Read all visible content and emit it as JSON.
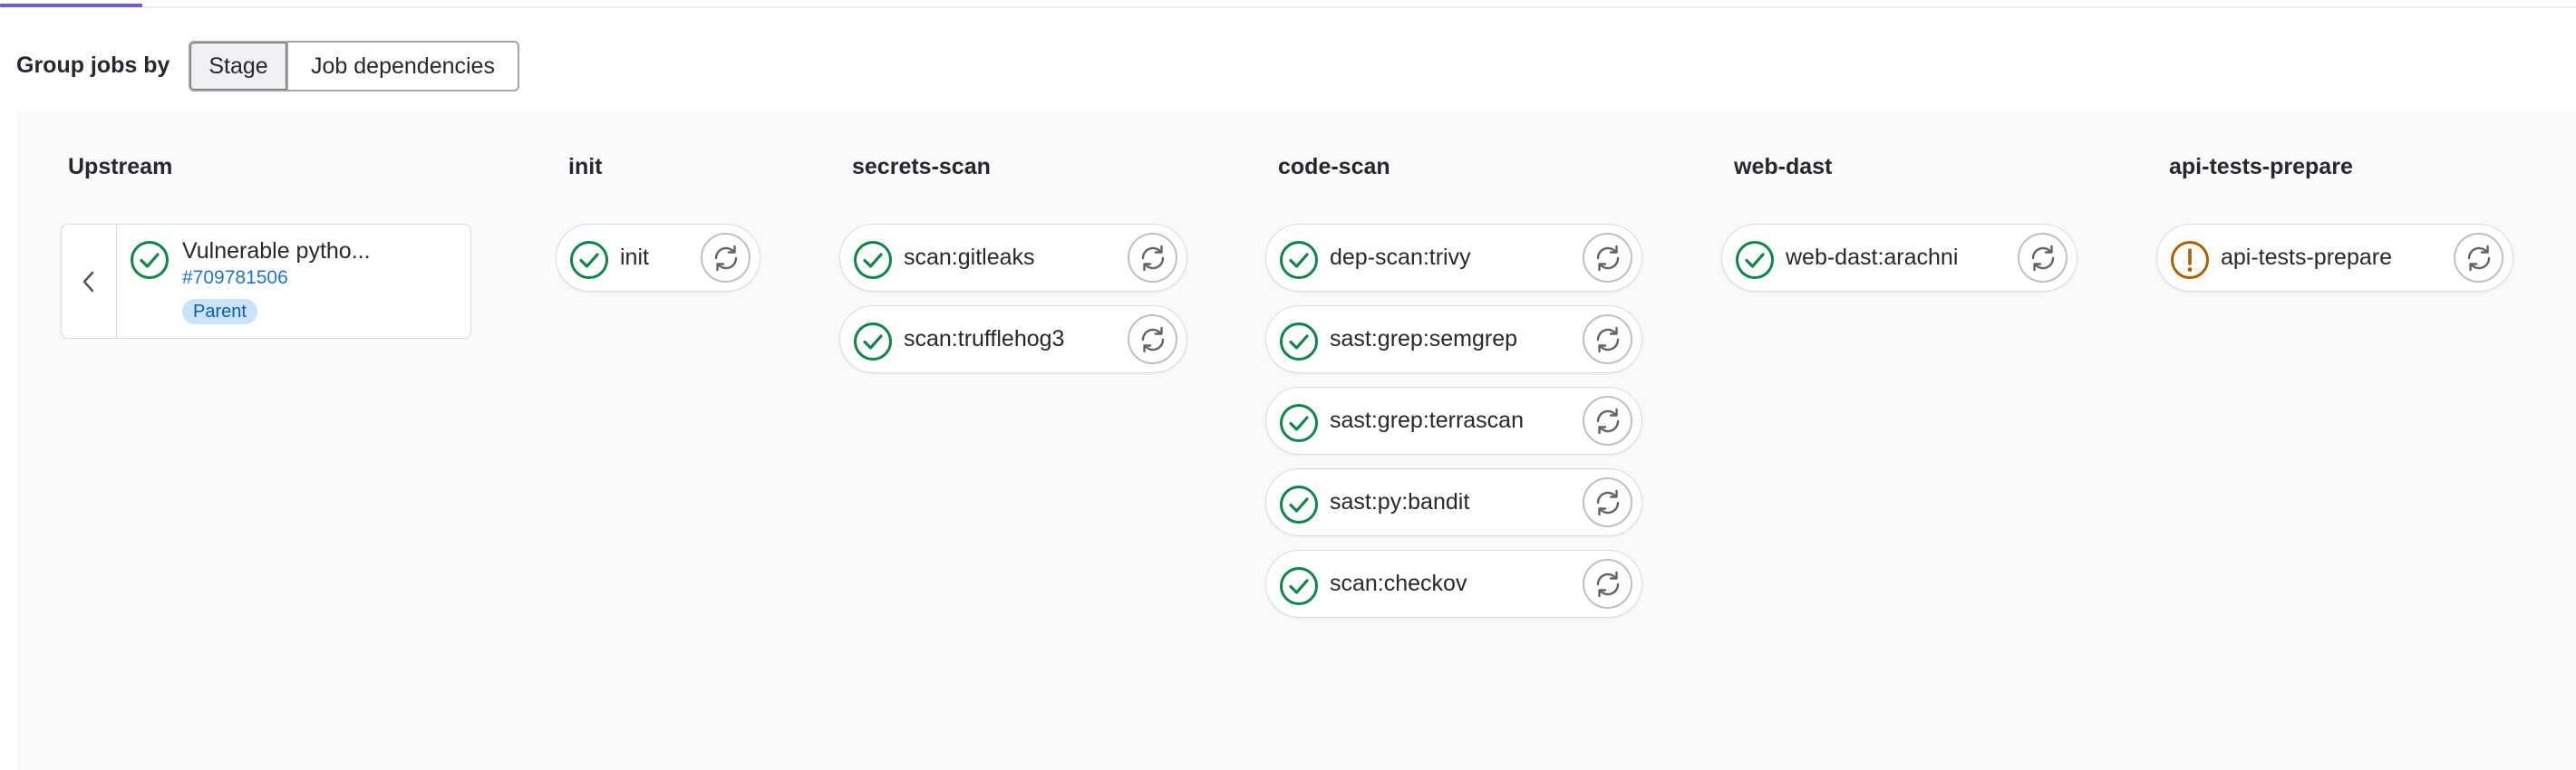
{
  "group_by": {
    "label": "Group jobs by",
    "options": [
      "Stage",
      "Job dependencies"
    ],
    "selected": "Stage"
  },
  "colors": {
    "success": "#108548",
    "warning": "#ab6100",
    "link": "#1f75cb",
    "tab_indicator": "#6b62c7"
  },
  "stages": {
    "upstream": {
      "title": "Upstream",
      "pipeline": {
        "name": "Vulnerable pytho...",
        "id": "#709781506",
        "badge": "Parent",
        "status": "success",
        "toggle_icon": "chevron-left-icon"
      }
    },
    "init": {
      "title": "init",
      "jobs": [
        {
          "name": "init",
          "status": "success"
        }
      ]
    },
    "secrets_scan": {
      "title": "secrets-scan",
      "jobs": [
        {
          "name": "scan:gitleaks",
          "status": "success"
        },
        {
          "name": "scan:trufflehog3",
          "status": "success"
        }
      ]
    },
    "code_scan": {
      "title": "code-scan",
      "jobs": [
        {
          "name": "dep-scan:trivy",
          "status": "success"
        },
        {
          "name": "sast:grep:semgrep",
          "status": "success"
        },
        {
          "name": "sast:grep:terrascan",
          "status": "success"
        },
        {
          "name": "sast:py:bandit",
          "status": "success"
        },
        {
          "name": "scan:checkov",
          "status": "success"
        }
      ]
    },
    "web_dast": {
      "title": "web-dast",
      "jobs": [
        {
          "name": "web-dast:arachni",
          "status": "success"
        }
      ]
    },
    "api_tests_prepare": {
      "title": "api-tests-prepare",
      "jobs": [
        {
          "name": "api-tests-prepare",
          "status": "warning"
        }
      ]
    }
  },
  "icons": {
    "success": "check-circle-icon",
    "warning": "exclamation-circle-icon",
    "retry": "retry-icon"
  }
}
